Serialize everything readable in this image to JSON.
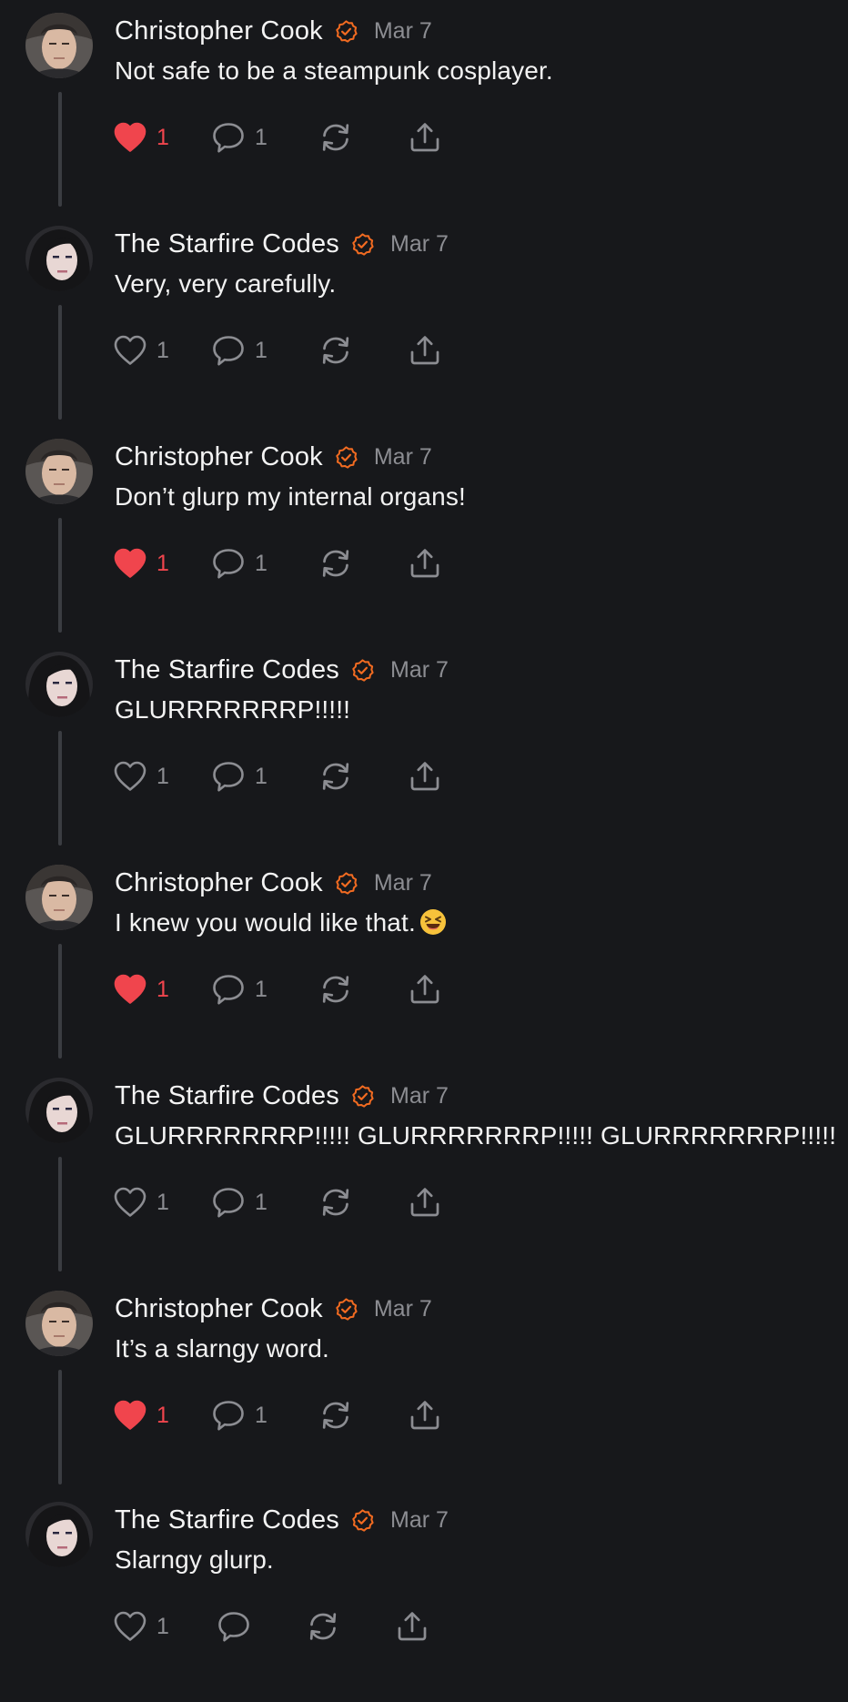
{
  "colors": {
    "background": "#17181b",
    "accent_verified": "#f26b21",
    "like_active": "#f0454d",
    "muted_text": "#8c8d92",
    "thread_line": "#3b3d42"
  },
  "icons": {
    "verified": "verified-badge-icon",
    "like": "heart-icon",
    "reply": "speech-bubble-icon",
    "repost": "repost-arrows-icon",
    "share": "share-upload-icon"
  },
  "posts": [
    {
      "author": "Christopher Cook",
      "date": "Mar 7",
      "text": "Not safe to be a steampunk cosplayer.",
      "likes": "1",
      "liked": true,
      "replies": "1"
    },
    {
      "author": "The Starfire Codes",
      "date": "Mar 7",
      "text": "Very, very carefully.",
      "likes": "1",
      "liked": false,
      "replies": "1"
    },
    {
      "author": "Christopher Cook",
      "date": "Mar 7",
      "text": "Don’t glurp my internal organs!",
      "likes": "1",
      "liked": true,
      "replies": "1"
    },
    {
      "author": "The Starfire Codes",
      "date": "Mar 7",
      "text": "GLURRRRRRRP!!!!!",
      "likes": "1",
      "liked": false,
      "replies": "1"
    },
    {
      "author": "Christopher Cook",
      "date": "Mar 7",
      "text": "I knew you would like that.",
      "emoji": "😆",
      "likes": "1",
      "liked": true,
      "replies": "1"
    },
    {
      "author": "The Starfire Codes",
      "date": "Mar 7",
      "text": "GLURRRRRRRP!!!!! GLURRRRRRRP!!!!! GLURRRRRRRP!!!!!",
      "likes": "1",
      "liked": false,
      "replies": "1"
    },
    {
      "author": "Christopher Cook",
      "date": "Mar 7",
      "text": "It’s a slarngy word.",
      "likes": "1",
      "liked": true,
      "replies": "1"
    },
    {
      "author": "The Starfire Codes",
      "date": "Mar 7",
      "text": "Slarngy glurp.",
      "likes": "1",
      "liked": false,
      "replies": ""
    }
  ]
}
